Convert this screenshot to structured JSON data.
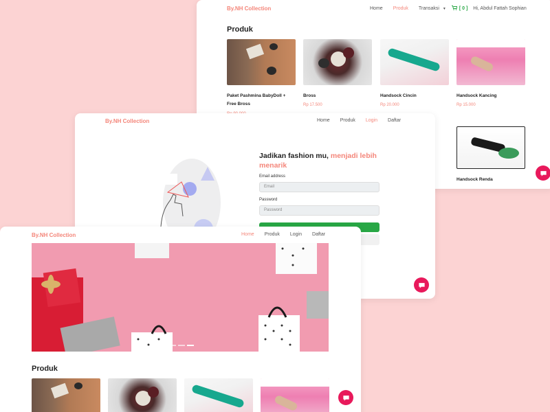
{
  "brand": "By.NH Collection",
  "back_window": {
    "nav": {
      "home": "Home",
      "produk": "Produk",
      "transaksi": "Transaksi",
      "cart_count": "[ 0 ]",
      "greeting": "Hi, Abdul Fattah Sophian"
    },
    "section_title": "Produk",
    "products": [
      {
        "name": "Paket Pashmina BabyDoll + Free Bross",
        "price": "Rp 90.000"
      },
      {
        "name": "Bross",
        "price": "Rp 17.500"
      },
      {
        "name": "Handsock Cincin",
        "price": "Rp 20.000"
      },
      {
        "name": "Handsock Kancing",
        "price": "Rp 15.000"
      },
      {
        "name": "Handsock Renda",
        "price": ""
      }
    ]
  },
  "login_window": {
    "nav": {
      "home": "Home",
      "produk": "Produk",
      "login": "Login",
      "daftar": "Daftar"
    },
    "headline_dark": "Jadikan fashion mu, ",
    "headline_accent": "menjadi lebih menarik",
    "email_label": "Email address",
    "email_placeholder": "Email",
    "password_label": "Password",
    "password_placeholder": "Password"
  },
  "front_window": {
    "nav": {
      "home": "Home",
      "produk": "Produk",
      "login": "Login",
      "daftar": "Daftar"
    },
    "section_title": "Produk"
  },
  "colors": {
    "accent": "#f4867a",
    "page_bg": "#fcd3d3",
    "chat": "#e8195b",
    "button": "#28a745"
  },
  "icons": {
    "cart": "cart-icon",
    "chat": "chat-icon",
    "caret": "caret-down-icon"
  }
}
